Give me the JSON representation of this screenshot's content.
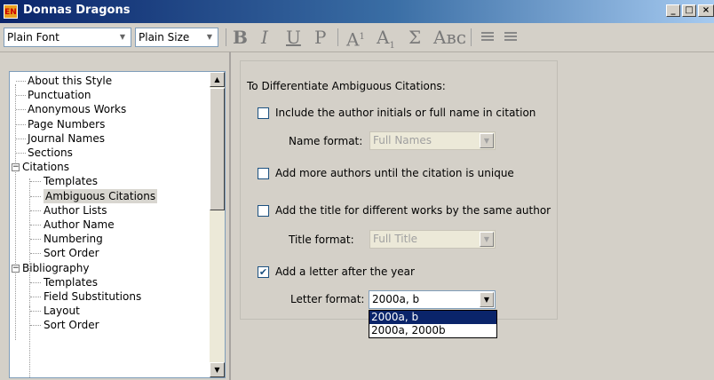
{
  "window": {
    "title": "Donnas Dragons",
    "icon_text": "EN",
    "controls": [
      "_",
      "□",
      "×"
    ]
  },
  "toolbar": {
    "font_select": "Plain Font",
    "size_select": "Plain Size",
    "bold": "B",
    "italic": "I",
    "underline": "U",
    "plain": "P",
    "superscript": "A",
    "superscript_mark": "1",
    "subscript": "A",
    "subscript_mark": "1",
    "symbol": "Σ",
    "small_caps": "Aʙᴄ"
  },
  "tree": {
    "items": [
      {
        "label": "About this Style"
      },
      {
        "label": "Punctuation"
      },
      {
        "label": "Anonymous Works"
      },
      {
        "label": "Page Numbers"
      },
      {
        "label": "Journal Names"
      },
      {
        "label": "Sections"
      },
      {
        "label": "Citations",
        "expander": "−"
      },
      {
        "label": "Templates"
      },
      {
        "label": "Ambiguous Citations",
        "selected": true
      },
      {
        "label": "Author Lists"
      },
      {
        "label": "Author Name"
      },
      {
        "label": "Numbering"
      },
      {
        "label": "Sort Order"
      },
      {
        "label": "Bibliography",
        "expander": "−"
      },
      {
        "label": "Templates"
      },
      {
        "label": "Field Substitutions"
      },
      {
        "label": "Layout"
      },
      {
        "label": "Sort Order"
      }
    ]
  },
  "panel": {
    "group_title": "To Differentiate Ambiguous Citations:",
    "opt_initials": {
      "label": "Include the author initials or full name in citation",
      "checked": false
    },
    "name_format": {
      "label": "Name format:",
      "value": "Full Names"
    },
    "opt_more_authors": {
      "label": "Add more authors until the citation is unique",
      "checked": false
    },
    "opt_title": {
      "label": "Add the title for different works by the same author",
      "checked": false
    },
    "title_format": {
      "label": "Title format:",
      "value": "Full Title"
    },
    "opt_letter": {
      "label": "Add a letter after the year",
      "checked": true,
      "mark": "✔"
    },
    "letter_format": {
      "label": "Letter format:",
      "value": "2000a, b",
      "options": [
        "2000a, b",
        "2000a, 2000b"
      ]
    }
  }
}
